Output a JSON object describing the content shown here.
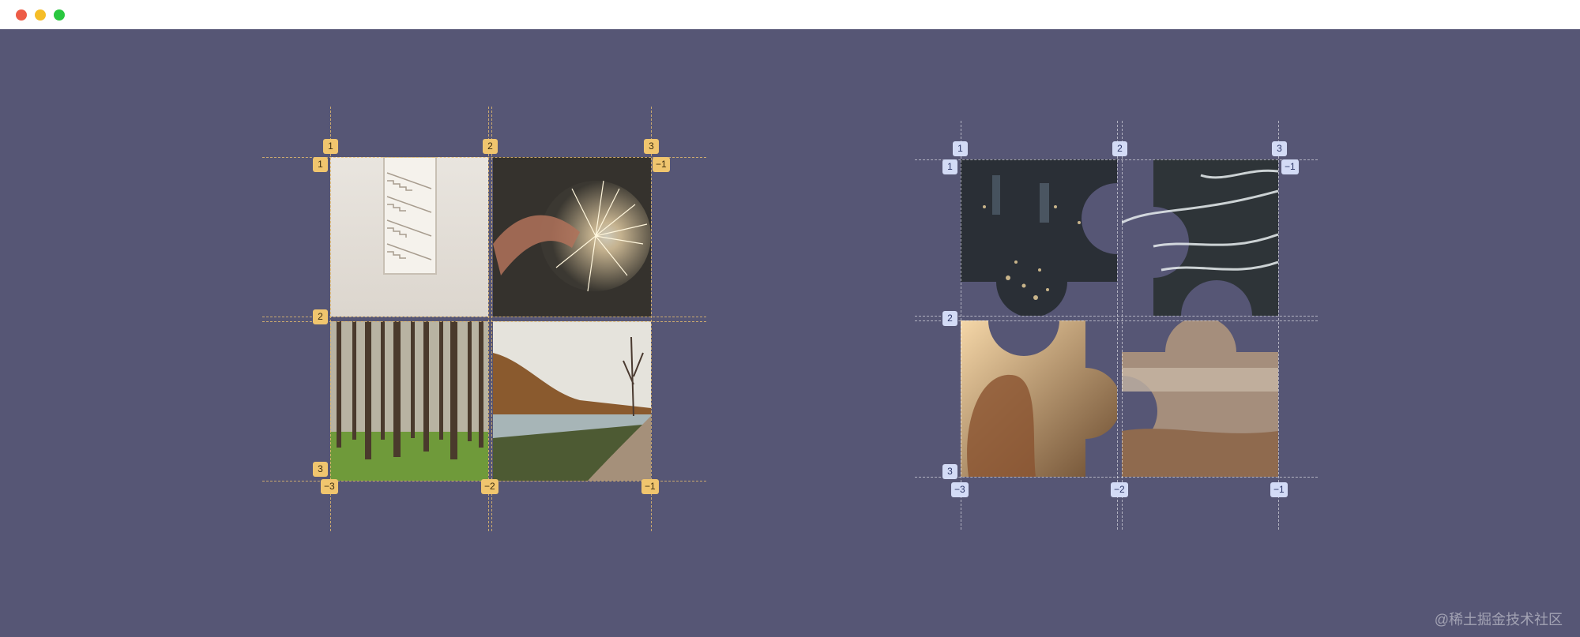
{
  "window": {
    "controls": [
      "close",
      "minimize",
      "zoom"
    ]
  },
  "colors": {
    "stage_background": "#565675",
    "gold_badge": "#f0c56e",
    "blue_badge": "#d3dbf6"
  },
  "left_grid": {
    "top_labels": [
      "1",
      "2",
      "3"
    ],
    "left_labels": [
      "1",
      "2",
      "3"
    ],
    "right_top_label": "−1",
    "bottom_labels": [
      "−3",
      "−2",
      "−1"
    ],
    "tiles": [
      "staircase-photo",
      "sparkler-photo",
      "forest-photo",
      "lake-road-photo"
    ]
  },
  "right_grid": {
    "top_labels": [
      "1",
      "2",
      "3"
    ],
    "left_labels": [
      "1",
      "2",
      "3"
    ],
    "right_top_label": "−1",
    "bottom_labels": [
      "−3",
      "−2",
      "−1"
    ],
    "tiles": [
      "night-city-photo",
      "ocean-waves-photo",
      "sunlit-hair-photo",
      "beach-photo"
    ]
  },
  "watermark": "@稀土掘金技术社区"
}
